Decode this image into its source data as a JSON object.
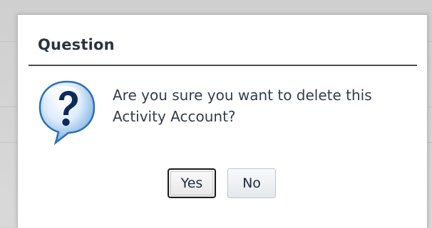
{
  "dialog": {
    "title": "Question",
    "icon": "question-speech-bubble-icon",
    "message": "Are you sure you want to delete this Activity Account?",
    "buttons": {
      "yes_label": "Yes",
      "no_label": "No"
    }
  },
  "colors": {
    "backdrop": "#d2d2d2",
    "dialog_background": "#ffffff",
    "title_text": "#2a3340",
    "message_text": "#333d4a",
    "icon_blue": "#2f6fb3",
    "icon_question_mark": "#0c2a5a"
  }
}
